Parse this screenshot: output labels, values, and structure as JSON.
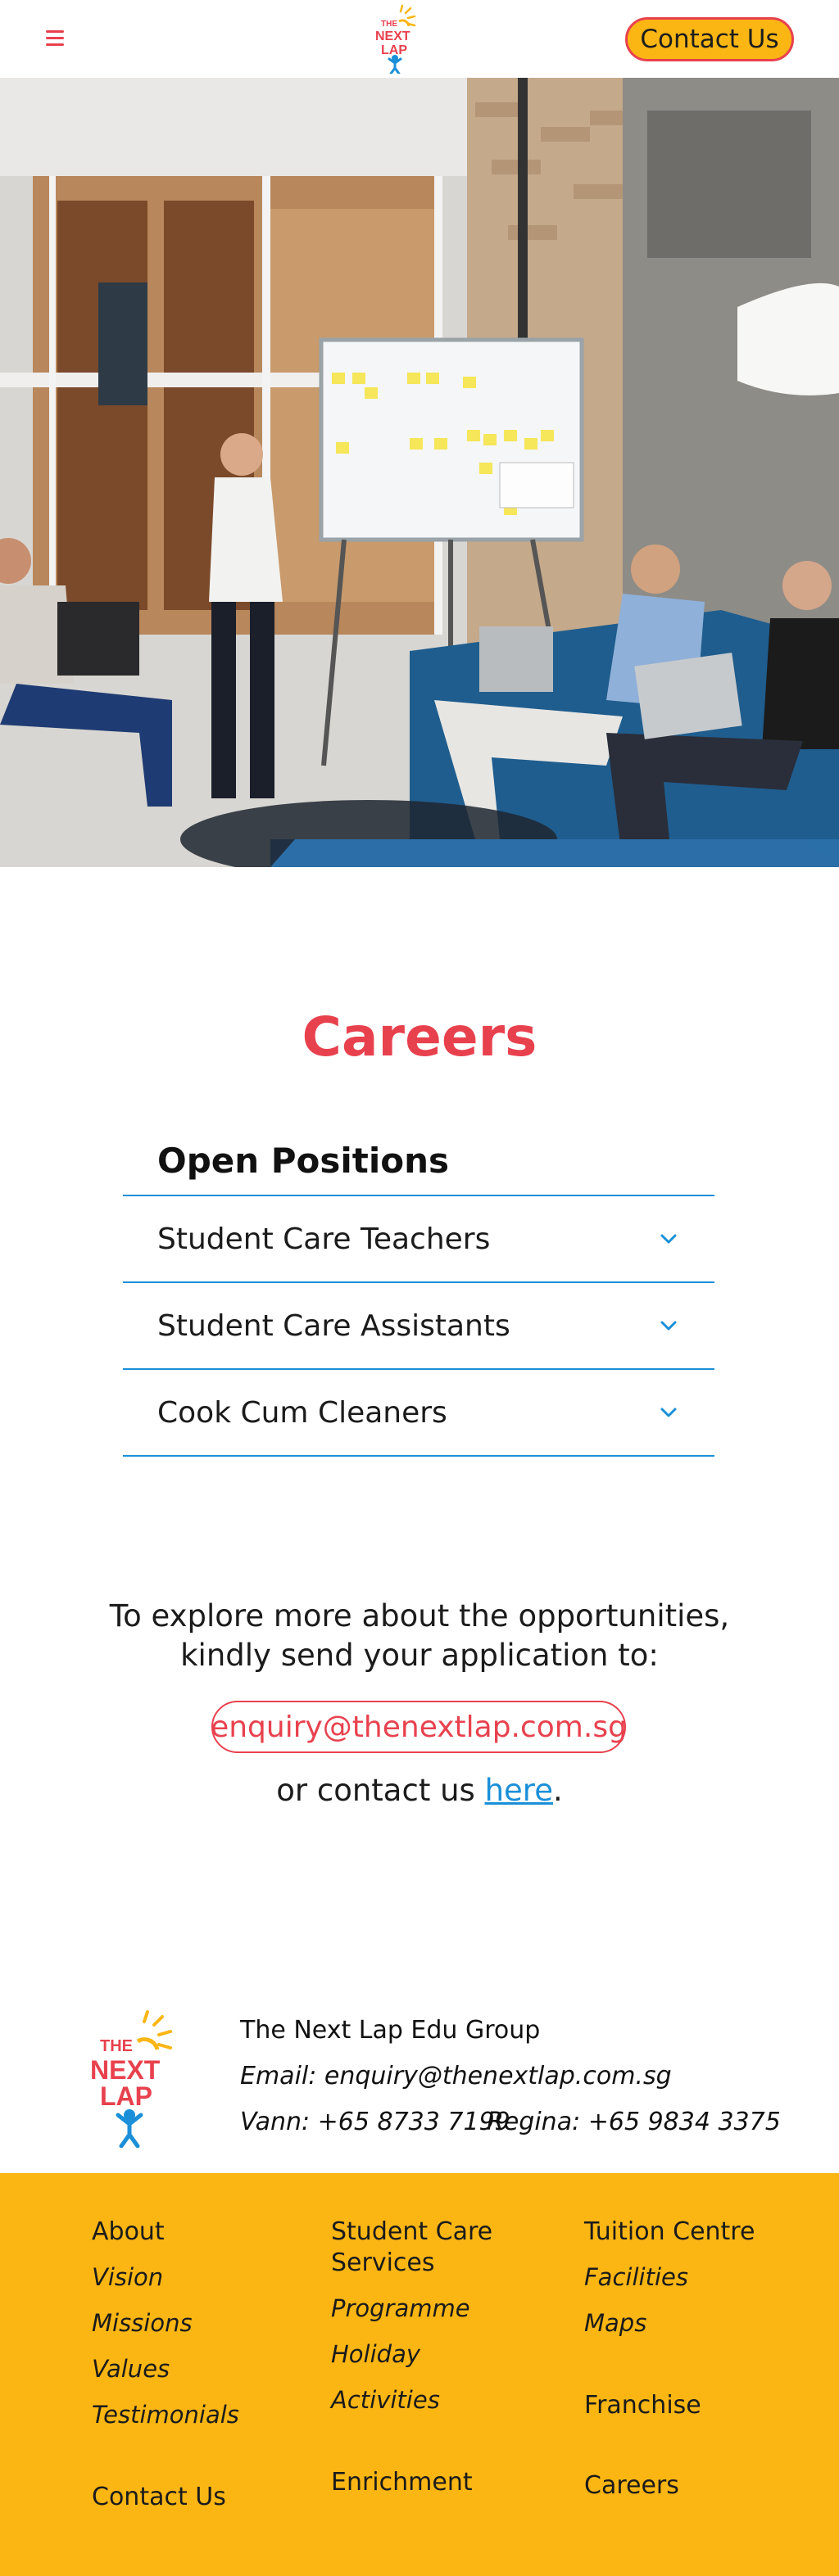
{
  "header": {
    "contact_label": "Contact Us",
    "logo_text": [
      "THE",
      "NEXT",
      "LAP"
    ]
  },
  "hero": {
    "image_description_icon": "office-meeting-photo"
  },
  "careers": {
    "title": "Careers",
    "section_title": "Open Positions",
    "positions": [
      "Student Care Teachers",
      "Student Care Assistants",
      "Cook Cum Cleaners"
    ]
  },
  "explore": {
    "line1": "To explore more about the opportunities,",
    "line2": "kindly send your application to:",
    "email": "enquiry@thenextlap.com.sg",
    "or_text": "or contact us ",
    "here": "here",
    "period": "."
  },
  "footer_info": {
    "company": "The Next Lap Edu Group",
    "email": "Email: enquiry@thenextlap.com.sg",
    "phone1": "Vann: +65 8733 7199",
    "phone2": "Regina: +65 9834 3375"
  },
  "footer": {
    "col1": {
      "about": "About",
      "vision": "Vision",
      "missions": "Missions",
      "values": "Values",
      "testimonials": "Testimonials",
      "contact": "Contact Us"
    },
    "col2": {
      "services_line1": "Student Care",
      "services_line2": "Services",
      "programme": "Programme",
      "holiday": "Holiday",
      "activities": "Activities",
      "enrichment": "Enrichment"
    },
    "col3": {
      "tuition": "Tuition Centre",
      "facilities": "Facilities",
      "maps": "Maps",
      "franchise": "Franchise",
      "careers": "Careers"
    }
  },
  "colors": {
    "accent_red": "#e8414e",
    "accent_yellow": "#fbb614",
    "accent_blue": "#1b8fd8"
  }
}
